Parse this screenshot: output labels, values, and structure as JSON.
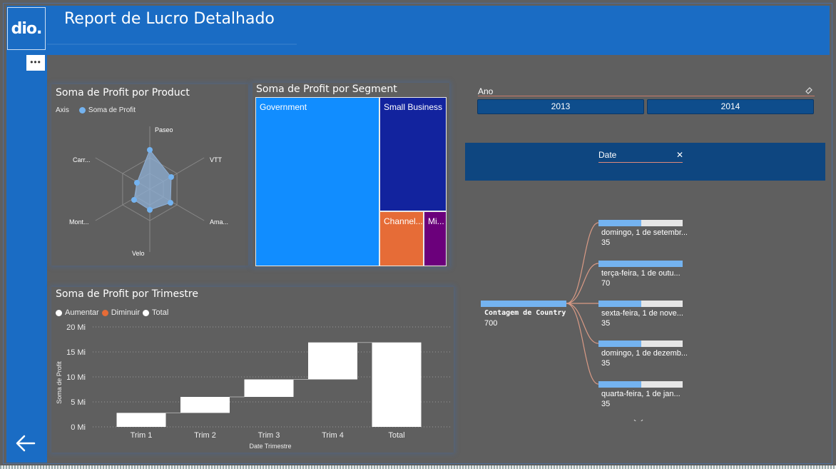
{
  "header": {
    "title": "Report de Lucro Detalhado",
    "logo": "dio."
  },
  "sidebar": {
    "more_label": "•••",
    "back_icon": "arrow-left-icon"
  },
  "radar": {
    "title": "Soma de Profit por Product",
    "legend_title": "Axis",
    "legend_series": "Soma de Profit",
    "axes": [
      "Paseo",
      "VTT",
      "Ama...",
      "Velo",
      "Mont...",
      "Carr..."
    ],
    "color": "#74b3f0"
  },
  "treemap": {
    "title": "Soma de Profit por Segment",
    "cells": [
      {
        "label": "Government",
        "color": "#118dff"
      },
      {
        "label": "Small Business",
        "color": "#12239e"
      },
      {
        "label": "Channel...",
        "color": "#e66c37"
      },
      {
        "label": "Mi...",
        "color": "#6b007b"
      }
    ]
  },
  "slicer": {
    "label": "Ano",
    "options": [
      "2013",
      "2014"
    ]
  },
  "decomp": {
    "field": "Date",
    "root_label": "Contagem de Country",
    "root_value": "700",
    "nodes": [
      {
        "label": "domingo, 1 de setembr...",
        "value": "35"
      },
      {
        "label": "terça-feira, 1 de outu...",
        "value": "70"
      },
      {
        "label": "sexta-feira, 1 de nove...",
        "value": "35"
      },
      {
        "label": "domingo, 1 de dezemb...",
        "value": "35"
      },
      {
        "label": "quarta-feira, 1 de jan...",
        "value": "35"
      }
    ]
  },
  "waterfall": {
    "title": "Soma de Profit por Trimestre",
    "legend": [
      {
        "label": "Aumentar",
        "color": "#ffffff"
      },
      {
        "label": "Diminuir",
        "color": "#e66c37"
      },
      {
        "label": "Total",
        "color": "#ffffff"
      }
    ],
    "ylabel": "Soma de Profit",
    "xlabel": "Date Trimestre"
  },
  "chart_data": {
    "type": "bar",
    "subtype": "waterfall",
    "title": "Soma de Profit por Trimestre",
    "xlabel": "Date Trimestre",
    "ylabel": "Soma de Profit",
    "categories": [
      "Trim 1",
      "Trim 2",
      "Trim 3",
      "Trim 4",
      "Total"
    ],
    "start": [
      0,
      2.8,
      6.0,
      9.5,
      0
    ],
    "end": [
      2.8,
      6.0,
      9.5,
      16.9,
      16.9
    ],
    "ylim": [
      0,
      20
    ],
    "yticks": [
      "0 Mi",
      "5 Mi",
      "10 Mi",
      "15 Mi",
      "20 Mi"
    ],
    "ytick_values": [
      0,
      5,
      10,
      15,
      20
    ],
    "grid": true
  }
}
